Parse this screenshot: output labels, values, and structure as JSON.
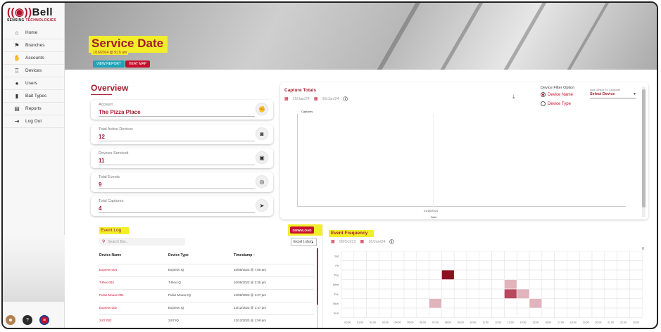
{
  "brand": {
    "name": "Bell",
    "sub_a": "SENSING",
    "sub_b": "TECHNOLOGIES"
  },
  "nav": [
    {
      "label": "Home",
      "icon": "⌂",
      "icon_name": "home-icon"
    },
    {
      "label": "Branches",
      "icon": "⚑",
      "icon_name": "branches-icon"
    },
    {
      "label": "Accounts",
      "icon": "✋",
      "icon_name": "accounts-icon"
    },
    {
      "label": "Devices",
      "icon": "♖",
      "icon_name": "devices-icon"
    },
    {
      "label": "Users",
      "icon": "●",
      "icon_name": "users-icon"
    },
    {
      "label": "Bait Types",
      "icon": "▮",
      "icon_name": "bait-types-icon"
    },
    {
      "label": "Reports",
      "icon": "▤",
      "icon_name": "reports-icon"
    },
    {
      "label": "Log Out",
      "icon": "⇥",
      "icon_name": "log-out-icon"
    }
  ],
  "banner": {
    "title": "Service Date",
    "date": "1/16/2024 @ 9:15 am",
    "view_report": "VIEW REPORT",
    "heat_map": "HEAT MAP"
  },
  "overview": {
    "title": "Overview",
    "stats": [
      {
        "label": "Account",
        "value": "The Pizza Place",
        "icon": "✊",
        "icon_name": "account-icon"
      },
      {
        "label": "Total Active Devices",
        "value": "12",
        "icon": "◙",
        "icon_name": "active-devices-icon"
      },
      {
        "label": "Devices Serviced",
        "value": "11",
        "icon": "▣",
        "icon_name": "clipboard-icon"
      },
      {
        "label": "Total Events",
        "value": "9",
        "icon": "◎",
        "icon_name": "events-icon"
      },
      {
        "label": "Total Captures",
        "value": "4",
        "icon": "➤",
        "icon_name": "captures-icon"
      }
    ]
  },
  "capture": {
    "title": "Capture Totals",
    "date_from": "16/Jan/24",
    "date_to": "16/Jan/24",
    "filter_title": "Device Filter Option",
    "opt_name": "Device Name",
    "opt_type": "Device Type",
    "add_label": "Add Device To Compare",
    "select_label": "Select Device",
    "legend": "Captures",
    "x_tick": "01/16/2024",
    "x_title": "Date"
  },
  "event_log": {
    "title": "Event Log",
    "search_placeholder": "Search Bar...",
    "download": "DOWNLOAD",
    "format": "Excel (.xlsx)",
    "columns": {
      "name": "Device Name",
      "type": "Device Type",
      "time": "Timestamp ↑"
    },
    "rows": [
      {
        "name": "Express 004",
        "type": "Express IQ",
        "time": "10/09/2023 @ 7:59 am"
      },
      {
        "name": "T-Rex 003",
        "type": "T-Rex IQ",
        "time": "10/09/2023 @ 3:35 pm"
      },
      {
        "name": "Pulse Mouse 001",
        "type": "Pulse Mouse IQ",
        "time": "12/06/2023 @ 1:27 pm"
      },
      {
        "name": "Express 002",
        "type": "Express IQ",
        "time": "12/12/2023 @ 1:47 pm"
      },
      {
        "name": "24/7 002",
        "type": "24/7 IQ",
        "time": "12/12/2023 @ 1:59 pm"
      }
    ]
  },
  "frequency": {
    "title": "Event Frequency",
    "date_from": "08/Oct/23",
    "date_to": "16/Jan/24",
    "days": [
      "Sat",
      "Fri",
      "Thu",
      "Wed",
      "Tue",
      "Mon",
      "Sun"
    ],
    "hours": [
      "00:00",
      "01:00",
      "02:00",
      "03:00",
      "04:00",
      "05:00",
      "06:00",
      "07:00",
      "08:00",
      "09:00",
      "10:00",
      "11:00",
      "12:00",
      "13:00",
      "14:00",
      "15:00",
      "16:00",
      "17:00",
      "18:00",
      "19:00",
      "20:00",
      "21:00",
      "22:00",
      "23:00"
    ],
    "cells": [
      {
        "day": "Thu",
        "hour": 8,
        "level": 3
      },
      {
        "day": "Wed",
        "hour": 13,
        "level": 1
      },
      {
        "day": "Tue",
        "hour": 13,
        "level": 2
      },
      {
        "day": "Tue",
        "hour": 14,
        "level": 1
      },
      {
        "day": "Mon",
        "hour": 7,
        "level": 1
      },
      {
        "day": "Mon",
        "hour": 15,
        "level": 1
      }
    ],
    "colors": {
      "1": "#e1b3bc",
      "2": "#b8485e",
      "3": "#8a1020"
    }
  },
  "colors": {
    "accent": "#c8102e",
    "title": "#a31d2c",
    "highlight": "#f2ee2a",
    "teal": "#1fa3b8"
  }
}
